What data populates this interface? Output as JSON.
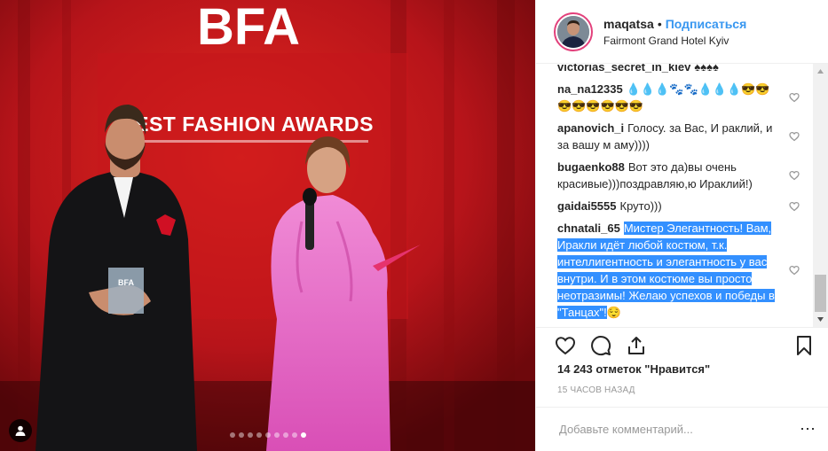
{
  "photo": {
    "banner_logo": "BFA",
    "banner_subtitle": "BEST FASHION AWARDS",
    "trophy_text": "BFA",
    "carousel_total": 9,
    "carousel_active": 8
  },
  "header": {
    "username": "maqatsa",
    "separator": "•",
    "follow_label": "Подписаться",
    "location": "Fairmont Grand Hotel Kyiv"
  },
  "comments": [
    {
      "author": "victorias_secret_in_kiev",
      "text": "♠♠♠♠",
      "selected": false
    },
    {
      "author": "na_na12335",
      "text": "💧💧💧🐾🐾💧💧💧😎😎😎😎😎😎😎😎",
      "selected": false
    },
    {
      "author": "apanovich_i",
      "text": "Голосу. за Вас, И раклий, и за вашу м аму))))",
      "selected": false
    },
    {
      "author": "bugaenko88",
      "text": "Вот это да)вы очень красивые)))поздравляю,ю Ираклий!)",
      "selected": false
    },
    {
      "author": "gaidai5555",
      "text": "Круто)))",
      "selected": false
    },
    {
      "author": "chnatali_65",
      "text": "Мистер Элегантность! Вам, Иракли идёт любой костюм, т.к. интеллигентность и элегантность у вас внутри. И в этом костюме вы просто неотразимы! Желаю успехов и победы в \"Танцах\"!",
      "trailing": "😌",
      "selected": true
    }
  ],
  "likes_label": "14 243 отметок \"Нравится\"",
  "time_label": "15 ЧАСОВ НАЗАД",
  "add_comment": {
    "placeholder": "Добавьте комментарий...",
    "value": ""
  },
  "icons": {
    "heart": "heart-icon",
    "comment": "comment-icon",
    "share": "share-icon",
    "save": "bookmark-icon",
    "more": "more-icon",
    "user_tag": "user-tag-icon"
  },
  "colors": {
    "follow": "#3897f0",
    "selection": "#3390ff",
    "story_ring": "#e2407b",
    "banner_red": "#c4161c"
  }
}
